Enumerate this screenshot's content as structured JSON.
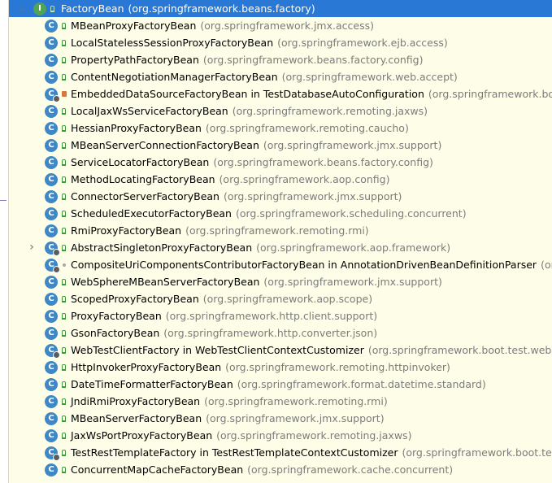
{
  "root": {
    "name": "FactoryBean",
    "package": "(org.springframework.beans.factory)",
    "icon": "interface-icon",
    "icon_letter": "I"
  },
  "items": [
    {
      "name": "MBeanProxyFactoryBean",
      "package": "(org.springframework.jmx.access)",
      "visibility": "public",
      "abstract": false,
      "expandable": false
    },
    {
      "name": "LocalStatelessSessionProxyFactoryBean",
      "package": "(org.springframework.ejb.access)",
      "visibility": "public",
      "abstract": false,
      "expandable": false
    },
    {
      "name": "PropertyPathFactoryBean",
      "package": "(org.springframework.beans.factory.config)",
      "visibility": "public",
      "abstract": false,
      "expandable": false
    },
    {
      "name": "ContentNegotiationManagerFactoryBean",
      "package": "(org.springframework.web.accept)",
      "visibility": "public",
      "abstract": false,
      "expandable": false
    },
    {
      "name": "EmbeddedDataSourceFactoryBean in TestDatabaseAutoConfiguration",
      "package": "(org.springframework.boot.test",
      "visibility": "private",
      "abstract": true,
      "expandable": false
    },
    {
      "name": "LocalJaxWsServiceFactoryBean",
      "package": "(org.springframework.remoting.jaxws)",
      "visibility": "public",
      "abstract": false,
      "expandable": false
    },
    {
      "name": "HessianProxyFactoryBean",
      "package": "(org.springframework.remoting.caucho)",
      "visibility": "public",
      "abstract": false,
      "expandable": false
    },
    {
      "name": "MBeanServerConnectionFactoryBean",
      "package": "(org.springframework.jmx.support)",
      "visibility": "public",
      "abstract": false,
      "expandable": false
    },
    {
      "name": "ServiceLocatorFactoryBean",
      "package": "(org.springframework.beans.factory.config)",
      "visibility": "public",
      "abstract": false,
      "expandable": false
    },
    {
      "name": "MethodLocatingFactoryBean",
      "package": "(org.springframework.aop.config)",
      "visibility": "public",
      "abstract": false,
      "expandable": false
    },
    {
      "name": "ConnectorServerFactoryBean",
      "package": "(org.springframework.jmx.support)",
      "visibility": "public",
      "abstract": false,
      "expandable": false
    },
    {
      "name": "ScheduledExecutorFactoryBean",
      "package": "(org.springframework.scheduling.concurrent)",
      "visibility": "public",
      "abstract": false,
      "expandable": false
    },
    {
      "name": "RmiProxyFactoryBean",
      "package": "(org.springframework.remoting.rmi)",
      "visibility": "public",
      "abstract": false,
      "expandable": false
    },
    {
      "name": "AbstractSingletonProxyFactoryBean",
      "package": "(org.springframework.aop.framework)",
      "visibility": "public",
      "abstract": true,
      "expandable": true
    },
    {
      "name": "CompositeUriComponentsContributorFactoryBean in AnnotationDrivenBeanDefinitionParser",
      "package": "(org.sprin",
      "visibility": "package",
      "abstract": true,
      "expandable": false
    },
    {
      "name": "WebSphereMBeanServerFactoryBean",
      "package": "(org.springframework.jmx.support)",
      "visibility": "public",
      "abstract": false,
      "expandable": false
    },
    {
      "name": "ScopedProxyFactoryBean",
      "package": "(org.springframework.aop.scope)",
      "visibility": "public",
      "abstract": false,
      "expandable": false
    },
    {
      "name": "ProxyFactoryBean",
      "package": "(org.springframework.http.client.support)",
      "visibility": "public",
      "abstract": false,
      "expandable": false
    },
    {
      "name": "GsonFactoryBean",
      "package": "(org.springframework.http.converter.json)",
      "visibility": "public",
      "abstract": false,
      "expandable": false
    },
    {
      "name": "WebTestClientFactory in WebTestClientContextCustomizer",
      "package": "(org.springframework.boot.test.web.reactiv",
      "visibility": "public",
      "abstract": true,
      "expandable": false
    },
    {
      "name": "HttpInvokerProxyFactoryBean",
      "package": "(org.springframework.remoting.httpinvoker)",
      "visibility": "public",
      "abstract": false,
      "expandable": false
    },
    {
      "name": "DateTimeFormatterFactoryBean",
      "package": "(org.springframework.format.datetime.standard)",
      "visibility": "public",
      "abstract": false,
      "expandable": false
    },
    {
      "name": "JndiRmiProxyFactoryBean",
      "package": "(org.springframework.remoting.rmi)",
      "visibility": "public",
      "abstract": false,
      "expandable": false
    },
    {
      "name": "MBeanServerFactoryBean",
      "package": "(org.springframework.jmx.support)",
      "visibility": "public",
      "abstract": false,
      "expandable": false
    },
    {
      "name": "JaxWsPortProxyFactoryBean",
      "package": "(org.springframework.remoting.jaxws)",
      "visibility": "public",
      "abstract": false,
      "expandable": false
    },
    {
      "name": "TestRestTemplateFactory in TestRestTemplateContextCustomizer",
      "package": "(org.springframework.boot.test.web.",
      "visibility": "public",
      "abstract": true,
      "expandable": false
    },
    {
      "name": "ConcurrentMapCacheFactoryBean",
      "package": "(org.springframework.cache.concurrent)",
      "visibility": "public",
      "abstract": false,
      "expandable": false
    }
  ],
  "colors": {
    "selection": "#2a78d6",
    "panel_background": "#fefee8",
    "package_text": "#7b7b7b",
    "class_icon": "#3f88c8",
    "interface_icon": "#50a454"
  },
  "icons": {
    "class": "class-icon",
    "expand": "chevron-right-icon",
    "public": "public-visibility-icon",
    "private": "private-visibility-icon",
    "package": "package-visibility-icon"
  }
}
